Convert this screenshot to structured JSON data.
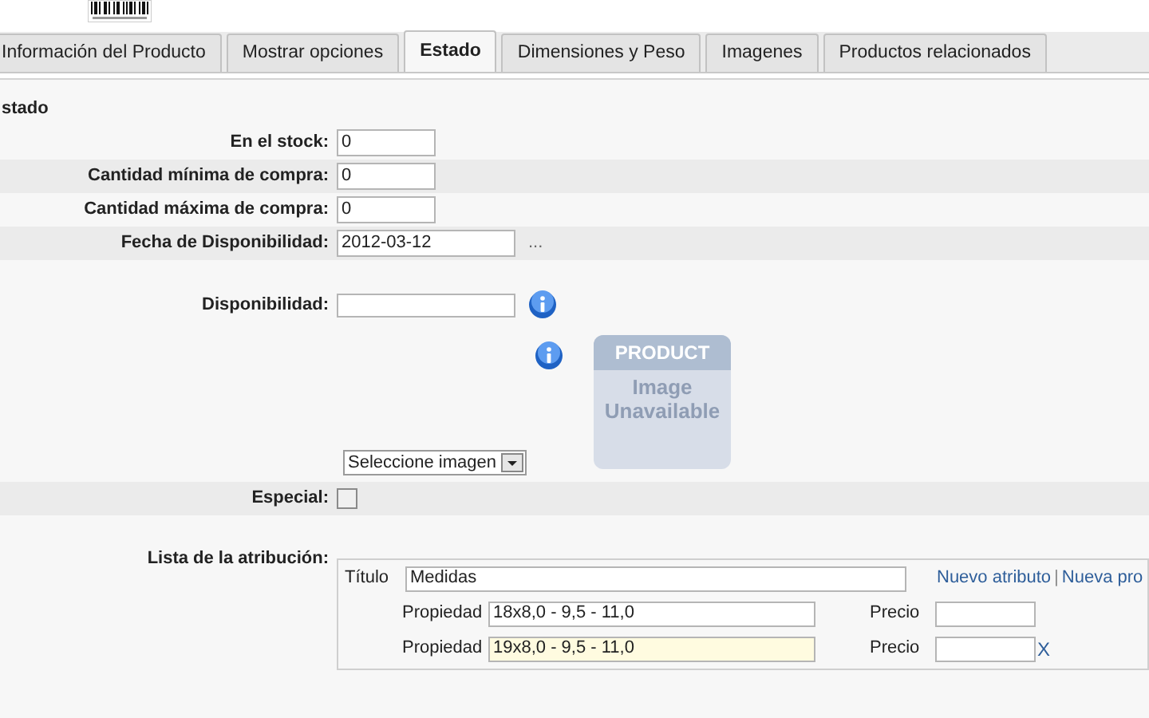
{
  "tabs": [
    {
      "label": "Información del Producto",
      "selected": false
    },
    {
      "label": "Mostrar opciones",
      "selected": false
    },
    {
      "label": "Estado",
      "selected": true
    },
    {
      "label": "Dimensiones y Peso",
      "selected": false
    },
    {
      "label": "Imagenes",
      "selected": false
    },
    {
      "label": "Productos relacionados",
      "selected": false
    }
  ],
  "section_title": "stado",
  "fields": [
    {
      "label": "En el stock:",
      "value": "0"
    },
    {
      "label": "Cantidad mínima de compra:",
      "value": "0"
    },
    {
      "label": "Cantidad máxima de compra:",
      "value": "0"
    },
    {
      "label": "Fecha de Disponibilidad:",
      "value": "2012-03-12",
      "button": "..."
    }
  ],
  "availability": {
    "label": "Disponibilidad:"
  },
  "image_placeholder": {
    "title": "PRODUCT",
    "line1": "Image",
    "line2": "Unavailable"
  },
  "image_select": {
    "value": "Seleccione imagen"
  },
  "special": {
    "label": "Especial:",
    "checked": false
  },
  "attributes": {
    "label": "Lista de la atribución:",
    "title_label": "Título",
    "title_value": "Medidas",
    "links": [
      "Nuevo atributo",
      "Nueva pro"
    ],
    "link_separator": "|",
    "properties": [
      {
        "label": "Propiedad",
        "value": "18x8,0 - 9,5 - 11,0",
        "focused": false,
        "price_label": "Precio"
      },
      {
        "label": "Propiedad",
        "value": "19x8,0 - 9,5 - 11,0",
        "focused": true,
        "price_label": "Precio",
        "remove": "X"
      }
    ]
  }
}
